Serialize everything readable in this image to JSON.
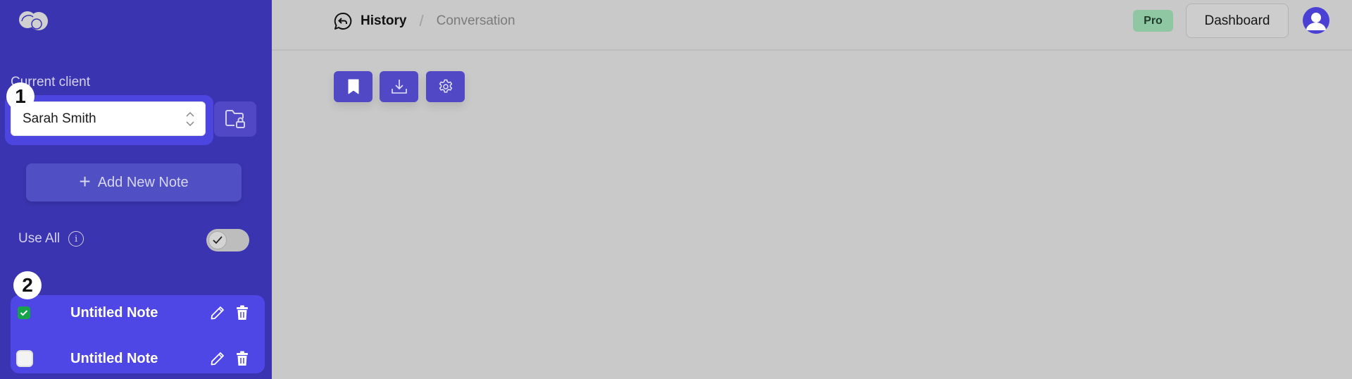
{
  "sidebar": {
    "current_client_label": "Current client",
    "client_select_value": "Sarah Smith",
    "add_note_label": "Add New Note",
    "use_all_label": "Use All",
    "use_all_toggle_checked": true,
    "badges": [
      "1",
      "2"
    ],
    "notes": [
      {
        "title": "Untitled Note",
        "checked": true
      },
      {
        "title": "Untitled Note",
        "checked": false
      }
    ]
  },
  "header": {
    "breadcrumb": {
      "history_label": "History",
      "separator": "/",
      "conversation_label": "Conversation"
    },
    "plan_badge": "Pro",
    "dashboard_label": "Dashboard"
  },
  "toolbar": {
    "buttons": [
      {
        "icon": "bookmark-icon"
      },
      {
        "icon": "download-icon"
      },
      {
        "icon": "settings-icon"
      }
    ]
  },
  "colors": {
    "sidebar_bg": "#3b34b0",
    "accent": "#4e46e5",
    "button_bg": "#5048c4",
    "checkbox_checked": "#16a34a",
    "pro_badge_bg": "#8fc7a3",
    "main_bg": "#c9c9c9"
  }
}
